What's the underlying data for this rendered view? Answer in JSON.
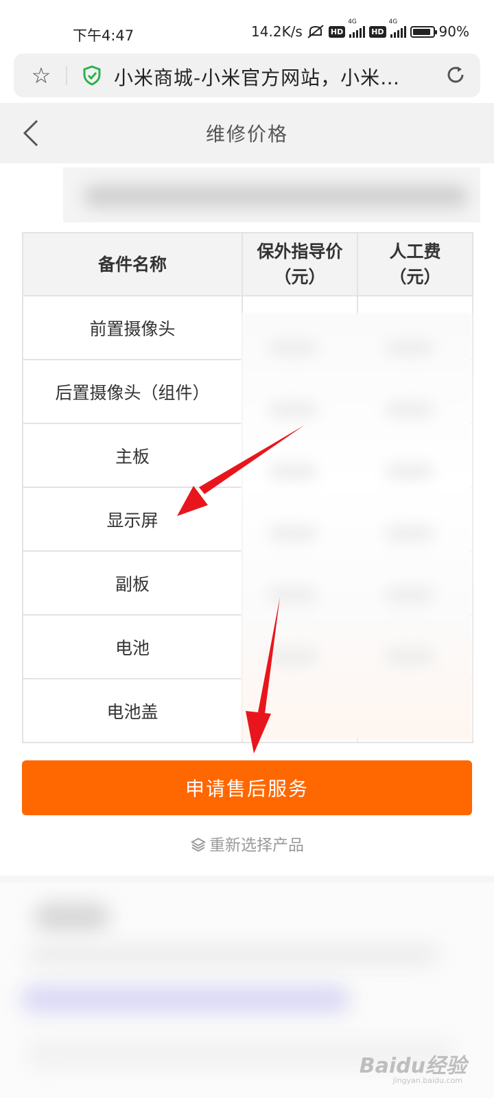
{
  "status_bar": {
    "time": "下午4:47",
    "speed": "14.2K/s",
    "hd": "HD",
    "net": "4G",
    "battery": "90%",
    "battery_level": 0.9
  },
  "browser": {
    "url_title": "小米商城-小米官方网站，小米…"
  },
  "header": {
    "title": "维修价格"
  },
  "table": {
    "headers": [
      "备件名称",
      "保外指导价\n（元）",
      "人工费\n（元）"
    ],
    "header_lines": [
      [
        "备件名称"
      ],
      [
        "保外指导价",
        "（元）"
      ],
      [
        "人工费",
        "（元）"
      ]
    ],
    "rows": [
      "前置摄像头",
      "后置摄像头（组件）",
      "主板",
      "显示屏",
      "副板",
      "电池",
      "电池盖"
    ]
  },
  "actions": {
    "apply_label": "申请售后服务",
    "reselect_label": "重新选择产品"
  },
  "watermark": {
    "brand": "Baidu经验",
    "sub": "jingyan.baidu.com"
  },
  "colors": {
    "accent": "#ff6700",
    "arrow": "#e8161c"
  }
}
